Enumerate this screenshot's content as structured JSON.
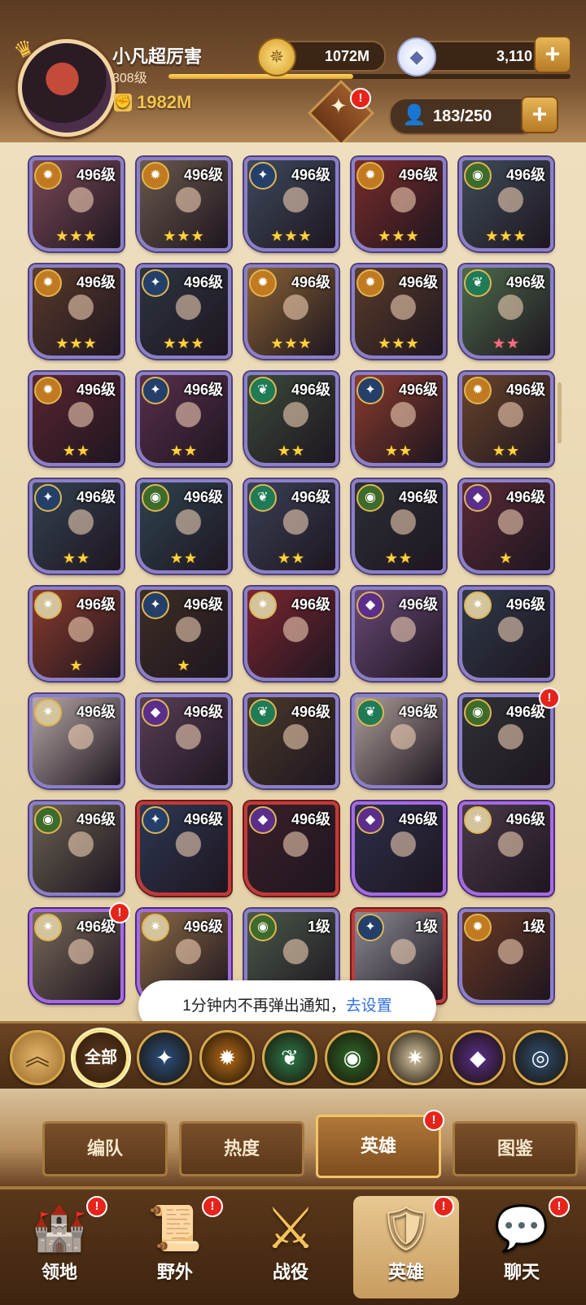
{
  "player": {
    "name": "小凡超厉害",
    "level": "308级",
    "power": "1982M",
    "xp_fraction": 0.46
  },
  "resources": {
    "gold": "1072M",
    "gems": "3,110",
    "plus": "+"
  },
  "roster": {
    "count": "183/250",
    "plus": "+"
  },
  "alert": "!",
  "heroes": [
    {
      "level": "496级",
      "stars": "★★★",
      "faction": "gold",
      "color": "#7b4a57",
      "frame": ""
    },
    {
      "level": "496级",
      "stars": "★★★",
      "faction": "gold",
      "color": "#6b5a4c",
      "frame": ""
    },
    {
      "level": "496级",
      "stars": "★★★",
      "faction": "blue",
      "color": "#3e4a5d",
      "frame": ""
    },
    {
      "level": "496级",
      "stars": "★★★",
      "faction": "gold",
      "color": "#7a2c2a",
      "frame": ""
    },
    {
      "level": "496级",
      "stars": "★★★",
      "faction": "green",
      "color": "#3f4d59",
      "frame": ""
    },
    {
      "level": "496级",
      "stars": "★★★",
      "faction": "gold",
      "color": "#5b3a2a",
      "frame": ""
    },
    {
      "level": "496级",
      "stars": "★★★",
      "faction": "blue",
      "color": "#2d3540",
      "frame": ""
    },
    {
      "level": "496级",
      "stars": "★★★",
      "faction": "gold",
      "color": "#8a6335",
      "frame": ""
    },
    {
      "level": "496级",
      "stars": "★★★",
      "faction": "gold",
      "color": "#5a3c2a",
      "frame": ""
    },
    {
      "level": "496级",
      "stars": "★★",
      "faction": "leaf",
      "color": "#4d6b4a",
      "frame": "",
      "pink": true
    },
    {
      "level": "496级",
      "stars": "★★",
      "faction": "gold",
      "color": "#5a2530",
      "frame": ""
    },
    {
      "level": "496级",
      "stars": "★★",
      "faction": "blue",
      "color": "#5a2f4c",
      "frame": ""
    },
    {
      "level": "496级",
      "stars": "★★",
      "faction": "leaf",
      "color": "#3b4a3a",
      "frame": ""
    },
    {
      "level": "496级",
      "stars": "★★",
      "faction": "blue",
      "color": "#8a3b2c",
      "frame": ""
    },
    {
      "level": "496级",
      "stars": "★★",
      "faction": "gold",
      "color": "#6a452b",
      "frame": ""
    },
    {
      "level": "496级",
      "stars": "★★",
      "faction": "blue",
      "color": "#344252",
      "frame": ""
    },
    {
      "level": "496级",
      "stars": "★★",
      "faction": "green",
      "color": "#2e4450",
      "frame": ""
    },
    {
      "level": "496级",
      "stars": "★★",
      "faction": "leaf",
      "color": "#3a4156",
      "frame": ""
    },
    {
      "level": "496级",
      "stars": "★★",
      "faction": "green",
      "color": "#2c2f36",
      "frame": ""
    },
    {
      "level": "496级",
      "stars": "★",
      "faction": "purple",
      "color": "#5a2a36",
      "frame": ""
    },
    {
      "level": "496级",
      "stars": "★",
      "faction": "light",
      "color": "#8a3b2c",
      "frame": ""
    },
    {
      "level": "496级",
      "stars": "★",
      "faction": "blue",
      "color": "#3d2e24",
      "frame": ""
    },
    {
      "level": "496级",
      "stars": "",
      "faction": "light",
      "color": "#7c2630",
      "frame": ""
    },
    {
      "level": "496级",
      "stars": "",
      "faction": "purple",
      "color": "#6a4a78",
      "frame": ""
    },
    {
      "level": "496级",
      "stars": "",
      "faction": "light",
      "color": "#2f3a4a",
      "frame": ""
    },
    {
      "level": "496级",
      "stars": "",
      "faction": "light",
      "color": "#b7a9a6",
      "frame": ""
    },
    {
      "level": "496级",
      "stars": "",
      "faction": "purple",
      "color": "#5a3f56",
      "frame": ""
    },
    {
      "level": "496级",
      "stars": "",
      "faction": "leaf",
      "color": "#4a3a2a",
      "frame": ""
    },
    {
      "level": "496级",
      "stars": "",
      "faction": "leaf",
      "color": "#ad9f9a",
      "frame": ""
    },
    {
      "level": "496级",
      "stars": "",
      "faction": "green",
      "color": "#2f3235",
      "frame": "",
      "dot": true
    },
    {
      "level": "496级",
      "stars": "",
      "faction": "green",
      "color": "#6b6252",
      "frame": ""
    },
    {
      "level": "496级",
      "stars": "",
      "faction": "blue",
      "color": "#2d3852",
      "frame": "red"
    },
    {
      "level": "496级",
      "stars": "",
      "faction": "purple",
      "color": "#3a1f2a",
      "frame": "red"
    },
    {
      "level": "496级",
      "stars": "",
      "faction": "purple",
      "color": "#2c2f4a",
      "frame": "purple"
    },
    {
      "level": "496级",
      "stars": "",
      "faction": "light",
      "color": "#4a3a48",
      "frame": "purple"
    },
    {
      "level": "496级",
      "stars": "",
      "faction": "light",
      "color": "#7a6a5a",
      "frame": "purple",
      "dot": true
    },
    {
      "level": "496级",
      "stars": "",
      "faction": "light",
      "color": "#8b6a44",
      "frame": "purple"
    },
    {
      "level": "1级",
      "stars": "",
      "faction": "green",
      "color": "#4a5a4a",
      "frame": ""
    },
    {
      "level": "1级",
      "stars": "",
      "faction": "blue",
      "color": "#8a8a92",
      "frame": "red"
    },
    {
      "level": "1级",
      "stars": "",
      "faction": "gold",
      "color": "#6a3a24",
      "frame": ""
    }
  ],
  "toast": {
    "text": "1分钟内不再弹出通知，",
    "link": "去设置"
  },
  "filters": {
    "all": "全部",
    "items": [
      {
        "name": "blue-star",
        "glyph": "✦",
        "color": "#2b4f7c"
      },
      {
        "name": "gold-sun",
        "glyph": "✹",
        "color": "#b66b17"
      },
      {
        "name": "leaf",
        "glyph": "❦",
        "color": "#2c7a4a"
      },
      {
        "name": "eye",
        "glyph": "◉",
        "color": "#2e6b2a"
      },
      {
        "name": "light",
        "glyph": "✷",
        "color": "#d8c7a3"
      },
      {
        "name": "dark",
        "glyph": "◆",
        "color": "#5a2e8a"
      },
      {
        "name": "ring",
        "glyph": "◎",
        "color": "#2f4f72"
      }
    ]
  },
  "subtabs": [
    "编队",
    "热度",
    "英雄",
    "图鉴"
  ],
  "nav": [
    {
      "label": "领地",
      "icon": "🏰",
      "dot": true
    },
    {
      "label": "野外",
      "icon": "📜",
      "dot": true
    },
    {
      "label": "战役",
      "icon": "⚔",
      "dot": false
    },
    {
      "label": "英雄",
      "icon": "🛡",
      "dot": true
    },
    {
      "label": "聊天",
      "icon": "💬",
      "dot": true
    }
  ]
}
